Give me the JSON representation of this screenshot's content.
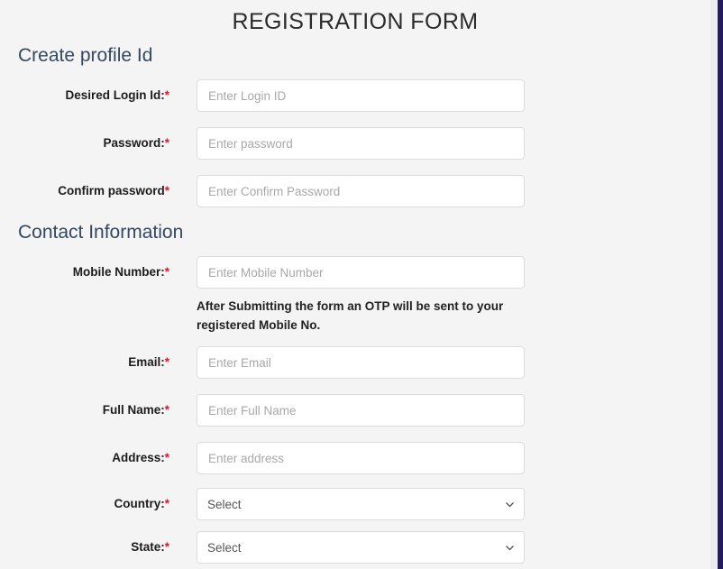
{
  "page": {
    "title": "REGISTRATION FORM",
    "background_color": "#f4f4f5",
    "accent_edge_color": "#231a5e",
    "required_marker": "*",
    "required_marker_color": "#e8112d",
    "section_heading_color": "#34495e"
  },
  "sections": [
    {
      "id": "profile",
      "heading": "Create profile Id"
    },
    {
      "id": "contact",
      "heading": "Contact Information"
    }
  ],
  "fields": [
    {
      "label": "Desired Login Id:",
      "placeholder": "Enter Login ID",
      "type": "text",
      "required": true
    },
    {
      "label": "Password:",
      "placeholder": "Enter password",
      "type": "password",
      "required": true
    },
    {
      "label": "Confirm password",
      "placeholder": "Enter Confirm Password",
      "type": "password",
      "required": true
    },
    {
      "label": "Mobile Number:",
      "placeholder": "Enter Mobile Number",
      "type": "text",
      "required": true
    },
    {
      "label": "Email:",
      "placeholder": "Enter Email",
      "type": "text",
      "required": true
    },
    {
      "label": "Full Name:",
      "placeholder": "Enter Full Name",
      "type": "text",
      "required": true
    },
    {
      "label": "Address:",
      "placeholder": "Enter address",
      "type": "text",
      "required": true
    },
    {
      "label": "Country:",
      "value": "Select",
      "type": "select",
      "required": true
    },
    {
      "label": "State:",
      "value": "Select",
      "type": "select",
      "required": true
    }
  ],
  "notes": {
    "otp": "After Submitting the form an OTP will be sent to your registered Mobile No."
  },
  "icons": {
    "chevron_down": "chevron-down-icon"
  }
}
